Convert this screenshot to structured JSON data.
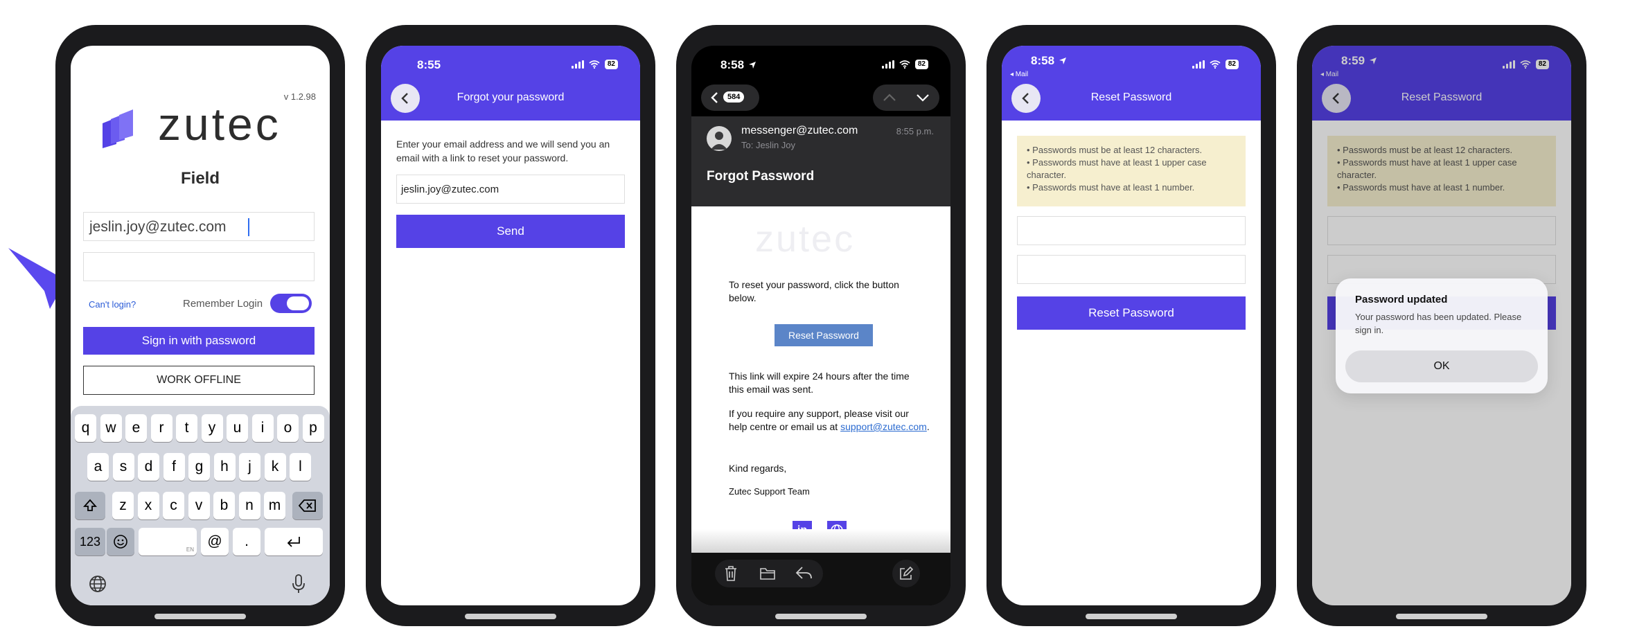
{
  "colors": {
    "brand": "#5542e6",
    "arrow": "#5a48ee"
  },
  "p1": {
    "version": "v 1.2.98",
    "brand": "zutec",
    "app_name": "Field",
    "email_value": "jeslin.joy@zutec.com",
    "cant_login": "Can't login?",
    "remember_label": "Remember Login",
    "remember_on": true,
    "signin_label": "Sign in with password",
    "offline_label": "WORK OFFLINE",
    "keyboard": {
      "row1": [
        "q",
        "w",
        "e",
        "r",
        "t",
        "y",
        "u",
        "i",
        "o",
        "p"
      ],
      "row2": [
        "a",
        "s",
        "d",
        "f",
        "g",
        "h",
        "j",
        "k",
        "l"
      ],
      "row3": [
        "z",
        "x",
        "c",
        "v",
        "b",
        "n",
        "m"
      ],
      "numbers_key": "123",
      "at_key": "@",
      "dot_key": ".",
      "space_lang": "EN",
      "icons": [
        "shift-icon",
        "backspace-icon",
        "emoji-icon",
        "return-icon",
        "globe-icon",
        "microphone-icon"
      ]
    }
  },
  "p2": {
    "time": "8:55",
    "battery": "82",
    "title": "Forgot your password",
    "description": "Enter your email address and we will send you an email with a link to reset your password.",
    "email_value": "jeslin.joy@zutec.com",
    "send_label": "Send"
  },
  "p3": {
    "time": "8:58",
    "battery": "82",
    "back_count": "584",
    "sender": "messenger@zutec.com",
    "to": "To: Jeslin Joy",
    "sent_time": "8:55 p.m.",
    "subject": "Forgot Password",
    "brand": "zutec",
    "body1": "To reset your password, click the button below.",
    "reset_label": "Reset Password",
    "body2": "This link will expire 24 hours after the time this email was sent.",
    "body3": "If you require any support, please visit our help centre or email us at",
    "support_link": "support@zutec.com",
    "regards": "Kind regards,",
    "team": "Zutec Support Team",
    "icons": [
      "linkedin-icon",
      "globe-icon",
      "trash-icon",
      "folder-icon",
      "reply-icon",
      "compose-icon"
    ]
  },
  "p4": {
    "time": "8:58",
    "back_app": "◂ Mail",
    "battery": "82",
    "title": "Reset Password",
    "rules": [
      "Passwords must be at least 12 characters.",
      "Passwords must have at least 1 upper case character.",
      "Passwords must have at least 1 number."
    ],
    "button": "Reset Password"
  },
  "p5": {
    "time": "8:59",
    "back_app": "◂ Mail",
    "battery": "82",
    "title": "Reset Password",
    "rules": [
      "Passwords must be at least 12 characters.",
      "Passwords must have at least 1 upper case character.",
      "Passwords must have at least 1 number."
    ],
    "dialog_title": "Password updated",
    "dialog_message": "Your password has been updated. Please sign in.",
    "ok_label": "OK"
  }
}
